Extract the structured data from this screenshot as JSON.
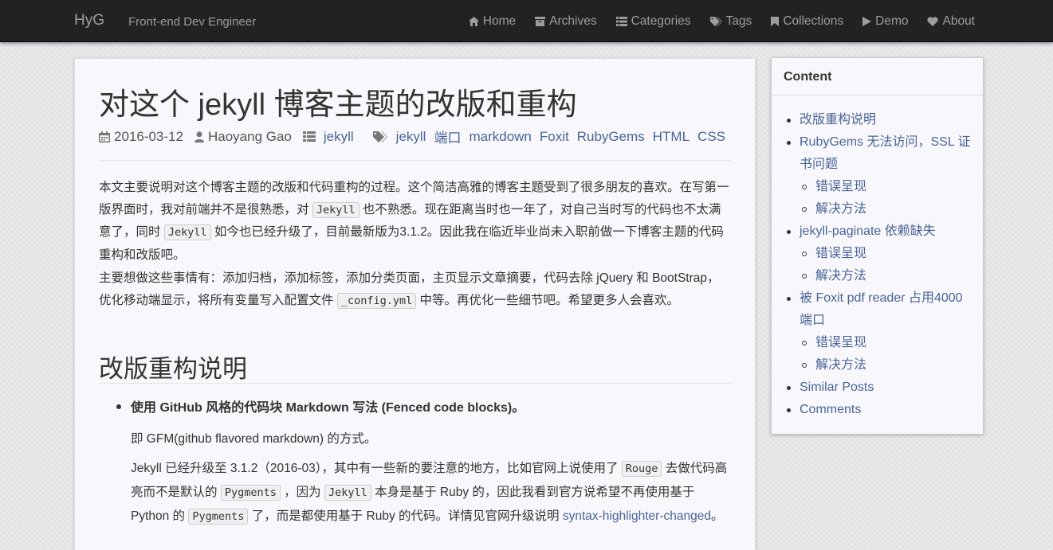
{
  "navbar": {
    "brand": "HyG",
    "tagline": "Front-end Dev Engineer",
    "items": [
      {
        "label": "Home",
        "icon": "home-icon"
      },
      {
        "label": "Archives",
        "icon": "archive-icon"
      },
      {
        "label": "Categories",
        "icon": "list-icon"
      },
      {
        "label": "Tags",
        "icon": "tags-icon"
      },
      {
        "label": "Collections",
        "icon": "bookmark-icon"
      },
      {
        "label": "Demo",
        "icon": "play-icon"
      },
      {
        "label": "About",
        "icon": "heart-icon"
      }
    ]
  },
  "article": {
    "title": "对这个 jekyll 博客主题的改版和重构",
    "date": "2016-03-12",
    "author": "Haoyang Gao",
    "category": "jekyll",
    "tags": [
      "jekyll",
      "端口",
      "markdown",
      "Foxit",
      "RubyGems",
      "HTML",
      "CSS"
    ],
    "p1": {
      "a": "本文主要说明对这个博客主题的改版和代码重构的过程。这个简洁高雅的博客主题受到了很多朋友的喜欢。在写第一版界面时，我对前端并不是很熟悉，对",
      "code1": "Jekyll",
      "b": "也不熟悉。现在距离当时也一年了，对自己当时写的代码也不太满意了，同时",
      "code2": "Jekyll",
      "c": "如今也已经升级了，目前最新版为3.1.2。因此我在临近毕业尚未入职前做一下博客主题的代码重构和改版吧。"
    },
    "p2": {
      "a": "主要想做这些事情有：添加归档，添加标签，添加分类页面，主页显示文章摘要，代码去除 jQuery 和 BootStrap，优化移动端显示，将所有变量写入配置文件",
      "code1": "_config.yml",
      "b": "中等。再优化一些细节吧。希望更多人会喜欢。"
    },
    "h2": "改版重构说明",
    "bullet": "使用 GitHub 风格的代码块 Markdown 写法 (Fenced code blocks)。",
    "sub1": "即 GFM(github flavored markdown) 的方式。",
    "sub2": {
      "a": "Jekyll 已经升级至 3.1.2（2016-03），其中有一些新的要注意的地方，比如官网上说使用了",
      "code1": "Rouge",
      "b": "去做代码高亮而不是默认的",
      "code2": "Pygments",
      "c": "，因为",
      "code3": "Jekyll",
      "d": "本身是基于 Ruby 的，因此我看到官方说希望不再使用基于 Python 的",
      "code4": "Pygments",
      "e": "了，而是都使用基于 Ruby 的代码。详情见官网升级说明",
      "link": "syntax-highlighter-changed",
      "f": "。"
    }
  },
  "toc": {
    "heading": "Content",
    "items": [
      {
        "label": "改版重构说明",
        "level": 1
      },
      {
        "label": "RubyGems 无法访问，SSL 证书问题",
        "level": 1
      },
      {
        "label": "错误呈现",
        "level": 2
      },
      {
        "label": "解决方法",
        "level": 2
      },
      {
        "label": "jekyll-paginate 依赖缺失",
        "level": 1
      },
      {
        "label": "错误呈现",
        "level": 2
      },
      {
        "label": "解决方法",
        "level": 2
      },
      {
        "label": "被 Foxit pdf reader 占用4000端口",
        "level": 1
      },
      {
        "label": "错误呈现",
        "level": 2
      },
      {
        "label": "解决方法",
        "level": 2
      },
      {
        "label": "Similar Posts",
        "level": 1
      },
      {
        "label": "Comments",
        "level": 1
      }
    ]
  }
}
